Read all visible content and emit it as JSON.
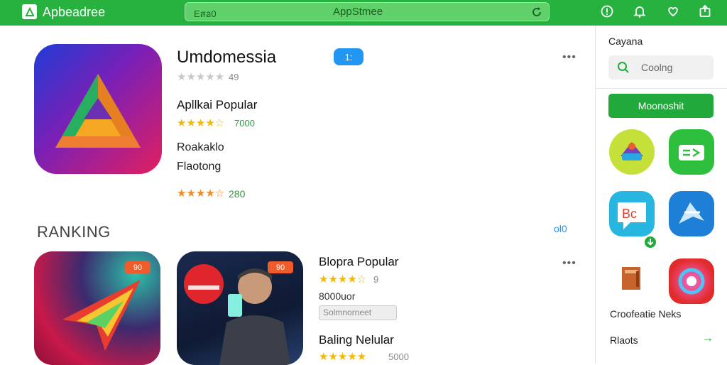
{
  "header": {
    "app_title": "Apbeadree",
    "search_left": "Eสอ0",
    "search_center": "AppStmee"
  },
  "hero": {
    "title": "Umdomessia",
    "badge": "1:",
    "rating_count": "49",
    "category_label": "Apllkai Popular",
    "category_rating": "7000",
    "line1": "Roakaklo",
    "line2": "Flaotong",
    "bottom_rating": "280"
  },
  "ranking": {
    "section_title": "RANKING",
    "see_all": "ol0",
    "card1_badge": "90",
    "card2_badge": "90",
    "item1_title": "Blopra Popular",
    "item1_rating": "9",
    "item1_meta": "8000uor",
    "item1_tag": "Solmnorneet",
    "item2_title": "Baling Nelular",
    "item2_rating": "5000"
  },
  "sidebar": {
    "title": "Cayana",
    "search_placeholder": "Coolng",
    "button_label": "Moonoshit",
    "footer_1": "Croofeatie Neks",
    "footer_2": "Rlaots"
  },
  "colors": {
    "brand_green": "#27b13f",
    "accent_blue": "#2196f3",
    "star_yellow": "#f5b800",
    "rating_green": "#2c9a3a"
  }
}
